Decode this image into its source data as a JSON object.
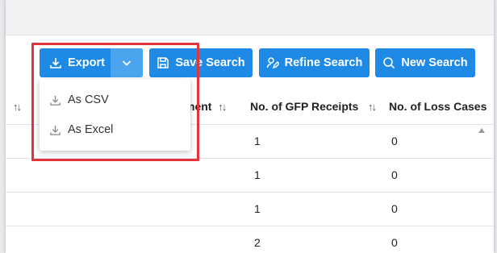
{
  "toolbar": {
    "export_label": "Export",
    "save_search_label": "Save Search",
    "refine_search_label": "Refine Search",
    "new_search_label": "New Search"
  },
  "export_menu": {
    "items": [
      {
        "label": "As CSV"
      },
      {
        "label": "As Excel"
      }
    ]
  },
  "table": {
    "columns": [
      {
        "label": "",
        "sort": "↑↓"
      },
      {
        "label": "ment",
        "sort": "↑↓"
      },
      {
        "label": "No. of GFP Receipts",
        "sort": "↑↓"
      },
      {
        "label": "No. of Loss Cases",
        "sort": ""
      }
    ],
    "rows": [
      {
        "gfp_receipts": "1",
        "loss_cases": "0"
      },
      {
        "gfp_receipts": "1",
        "loss_cases": "0"
      },
      {
        "gfp_receipts": "1",
        "loss_cases": "0"
      },
      {
        "gfp_receipts": "2",
        "loss_cases": "0"
      }
    ]
  },
  "colors": {
    "primary": "#1f8ae6",
    "caret": "#4ba4ee",
    "highlight": "#e0353b"
  }
}
